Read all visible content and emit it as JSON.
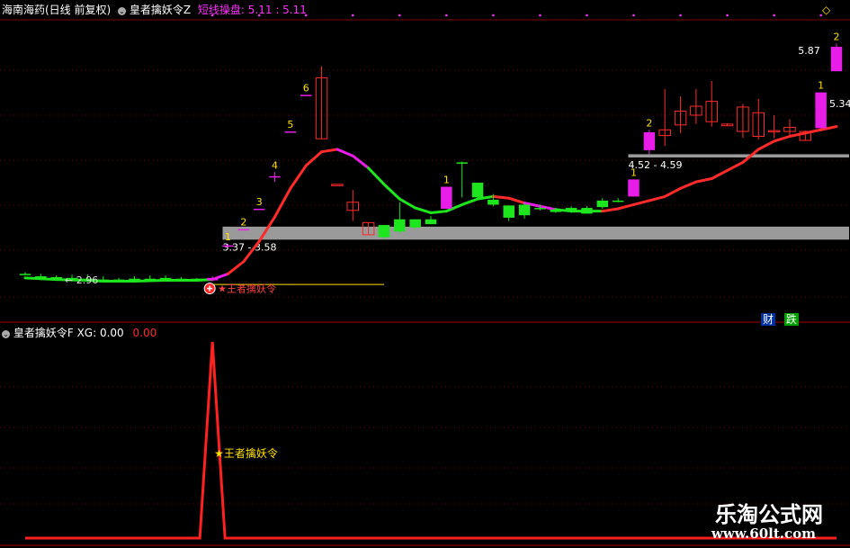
{
  "header": {
    "stock": "海南海药(日线 前复权)",
    "indicator1": "皇者擒妖令Z",
    "signal_label": "短线操盘:",
    "signal_values": "5.11 : 5.11",
    "indicator2": "皇者擒妖令F",
    "xg_label": "XG: 0.00",
    "xg_value2": "0.00"
  },
  "watermark": {
    "brand": "乐淘公式网",
    "url": "www.60lt.com"
  },
  "colors": {
    "up": "#ff2a2a",
    "down": "#1ee61e",
    "magenta": "#e81ee8",
    "gray": "#9a9a9a",
    "yellow": "#ffe000",
    "grid": "#6a0000"
  },
  "chart_data": [
    {
      "type": "candlestick",
      "price_range": [
        2.6,
        6.15
      ],
      "candles": [
        {
          "o": 3.05,
          "h": 3.07,
          "l": 3.03,
          "c": 3.05,
          "col": "down"
        },
        {
          "o": 3.02,
          "h": 3.05,
          "l": 2.99,
          "c": 3.0,
          "col": "down"
        },
        {
          "o": 3.01,
          "h": 3.03,
          "l": 2.98,
          "c": 2.99,
          "col": "down"
        },
        {
          "o": 3.0,
          "h": 3.04,
          "l": 2.97,
          "c": 2.98,
          "col": "down"
        },
        {
          "o": 2.99,
          "h": 3.04,
          "l": 2.95,
          "c": 2.97,
          "col": "down"
        },
        {
          "o": 2.98,
          "h": 3.02,
          "l": 2.96,
          "c": 2.97,
          "col": "down"
        },
        {
          "o": 2.98,
          "h": 3.0,
          "l": 2.96,
          "c": 2.97,
          "col": "down"
        },
        {
          "o": 2.99,
          "h": 3.02,
          "l": 2.96,
          "c": 2.97,
          "col": "down"
        },
        {
          "o": 2.99,
          "h": 3.03,
          "l": 2.97,
          "c": 2.98,
          "col": "down"
        },
        {
          "o": 3.0,
          "h": 3.03,
          "l": 2.97,
          "c": 2.98,
          "col": "down"
        },
        {
          "o": 2.99,
          "h": 3.01,
          "l": 2.96,
          "c": 2.97,
          "col": "down"
        },
        {
          "o": 2.96,
          "h": 3.0,
          "l": 2.96,
          "c": 2.99,
          "col": "down"
        },
        {
          "o": 2.97,
          "h": 3.02,
          "l": 2.96,
          "c": 3.0,
          "col": "magenta"
        },
        {
          "o": 3.4,
          "h": 3.42,
          "l": 3.37,
          "c": 3.4,
          "col": "magenta",
          "num": "1"
        },
        {
          "o": 3.6,
          "h": 3.6,
          "l": 3.6,
          "c": 3.6,
          "col": "magenta",
          "num": "2"
        },
        {
          "o": 3.85,
          "h": 3.85,
          "l": 3.85,
          "c": 3.85,
          "col": "magenta",
          "num": "3"
        },
        {
          "o": 4.25,
          "h": 4.3,
          "l": 4.18,
          "c": 4.25,
          "col": "magenta",
          "num": "4"
        },
        {
          "o": 4.8,
          "h": 4.8,
          "l": 4.8,
          "c": 4.8,
          "col": "magenta",
          "num": "5"
        },
        {
          "o": 5.25,
          "h": 5.25,
          "l": 5.25,
          "c": 5.25,
          "col": "magenta",
          "num": "6"
        },
        {
          "o": 4.71,
          "h": 5.6,
          "l": 4.71,
          "c": 5.46,
          "col": "up"
        },
        {
          "o": 4.15,
          "h": 4.15,
          "l": 4.15,
          "c": 4.15,
          "col": "up"
        },
        {
          "o": 3.83,
          "h": 4.08,
          "l": 3.7,
          "c": 3.93,
          "col": "up"
        },
        {
          "o": 3.53,
          "h": 3.68,
          "l": 3.53,
          "c": 3.68,
          "col": "up"
        },
        {
          "o": 3.65,
          "h": 3.65,
          "l": 3.48,
          "c": 3.5,
          "col": "down"
        },
        {
          "o": 3.72,
          "h": 3.93,
          "l": 3.55,
          "c": 3.57,
          "col": "down"
        },
        {
          "o": 3.72,
          "h": 3.72,
          "l": 3.6,
          "c": 3.62,
          "col": "down"
        },
        {
          "o": 3.72,
          "h": 3.76,
          "l": 3.66,
          "c": 3.66,
          "col": "down"
        },
        {
          "o": 3.85,
          "h": 4.12,
          "l": 3.85,
          "c": 4.12,
          "col": "magenta",
          "num": "1"
        },
        {
          "o": 4.42,
          "h": 4.43,
          "l": 3.99,
          "c": 4.41,
          "col": "down"
        },
        {
          "o": 4.17,
          "h": 4.17,
          "l": 3.98,
          "c": 3.99,
          "col": "down"
        },
        {
          "o": 3.96,
          "h": 4.03,
          "l": 3.88,
          "c": 3.9,
          "col": "down"
        },
        {
          "o": 3.89,
          "h": 3.89,
          "l": 3.7,
          "c": 3.74,
          "col": "down"
        },
        {
          "o": 3.9,
          "h": 3.92,
          "l": 3.73,
          "c": 3.77,
          "col": "down"
        },
        {
          "o": 3.86,
          "h": 3.9,
          "l": 3.83,
          "c": 3.86,
          "col": "down"
        },
        {
          "o": 3.84,
          "h": 3.86,
          "l": 3.8,
          "c": 3.81,
          "col": "down"
        },
        {
          "o": 3.86,
          "h": 3.88,
          "l": 3.8,
          "c": 3.83,
          "col": "down"
        },
        {
          "o": 3.86,
          "h": 3.88,
          "l": 3.79,
          "c": 3.79,
          "col": "down"
        },
        {
          "o": 3.95,
          "h": 3.98,
          "l": 3.85,
          "c": 3.87,
          "col": "down"
        },
        {
          "o": 3.95,
          "h": 3.98,
          "l": 3.93,
          "c": 3.95,
          "col": "down"
        },
        {
          "o": 4.0,
          "h": 4.21,
          "l": 4.0,
          "c": 4.21,
          "col": "magenta",
          "num": "1"
        },
        {
          "o": 4.57,
          "h": 4.82,
          "l": 4.52,
          "c": 4.79,
          "col": "magenta",
          "num": "2"
        },
        {
          "o": 4.75,
          "h": 5.32,
          "l": 4.62,
          "c": 4.82,
          "col": "up"
        },
        {
          "o": 4.88,
          "h": 5.23,
          "l": 4.78,
          "c": 5.05,
          "col": "up"
        },
        {
          "o": 5.0,
          "h": 5.32,
          "l": 4.89,
          "c": 5.11,
          "col": "up"
        },
        {
          "o": 4.92,
          "h": 5.42,
          "l": 4.86,
          "c": 5.17,
          "col": "up"
        },
        {
          "o": 4.87,
          "h": 4.9,
          "l": 4.87,
          "c": 4.89,
          "col": "up"
        },
        {
          "o": 4.8,
          "h": 5.14,
          "l": 4.72,
          "c": 5.1,
          "col": "up"
        },
        {
          "o": 4.74,
          "h": 5.2,
          "l": 4.7,
          "c": 5.03,
          "col": "up"
        },
        {
          "o": 4.81,
          "h": 5.0,
          "l": 4.72,
          "c": 4.8,
          "col": "up"
        },
        {
          "o": 4.8,
          "h": 4.95,
          "l": 4.75,
          "c": 4.85,
          "col": "up"
        },
        {
          "o": 4.69,
          "h": 4.81,
          "l": 4.69,
          "c": 4.8,
          "col": "up"
        },
        {
          "o": 4.84,
          "h": 5.28,
          "l": 4.84,
          "c": 5.28,
          "col": "magenta",
          "num": "1"
        },
        {
          "o": 5.54,
          "h": 5.88,
          "l": 5.54,
          "c": 5.84,
          "col": "magenta",
          "num": "2"
        }
      ],
      "ma_line": {
        "values": [
          3.0,
          2.99,
          2.98,
          2.975,
          2.97,
          2.96,
          2.96,
          2.96,
          2.965,
          2.97,
          2.97,
          2.97,
          2.98,
          3.05,
          3.2,
          3.45,
          3.75,
          4.1,
          4.38,
          4.55,
          4.58,
          4.5,
          4.35,
          4.15,
          3.97,
          3.86,
          3.8,
          3.82,
          3.9,
          3.97,
          4.0,
          3.98,
          3.92,
          3.88,
          3.84,
          3.82,
          3.82,
          3.82,
          3.85,
          3.9,
          3.95,
          4.0,
          4.1,
          4.18,
          4.22,
          4.32,
          4.42,
          4.58,
          4.68,
          4.74,
          4.78,
          4.82,
          4.86
        ],
        "colors": [
          "down",
          "down",
          "down",
          "down",
          "down",
          "down",
          "down",
          "down",
          "down",
          "down",
          "down",
          "down",
          "magenta",
          "up",
          "up",
          "up",
          "up",
          "up",
          "up",
          "up",
          "magenta",
          "magenta",
          "down",
          "down",
          "down",
          "down",
          "down",
          "down",
          "down",
          "down",
          "up",
          "up",
          "magenta",
          "magenta",
          "down",
          "down",
          "down",
          "up",
          "up",
          "up",
          "up",
          "up",
          "up",
          "up",
          "up",
          "up",
          "up",
          "up",
          "up",
          "up",
          "up",
          "up",
          "up"
        ]
      },
      "zones": [
        {
          "from": 13,
          "to": 52,
          "top": 3.63,
          "bottom": 3.47,
          "label": "3.37 - 3.58",
          "label_index": 13,
          "label_price": 3.38
        },
        {
          "from": 39,
          "to": 52,
          "top": 4.52,
          "bottom": 4.48,
          "label": "4.52 - 4.59",
          "label_index": 39,
          "label_price": 4.39
        }
      ],
      "annotations": [
        {
          "text": "← 2.96",
          "index": 3,
          "price": 2.93,
          "color": "#dddddd"
        },
        {
          "text": "5.87",
          "index": 50,
          "price": 5.75,
          "color": "#ffffff"
        },
        {
          "text": "5.34",
          "index": 52,
          "price": 5.1,
          "color": "#ffffff"
        }
      ],
      "signal": {
        "index": 12,
        "label": "王者擒妖令",
        "price": 2.87
      }
    },
    {
      "type": "line",
      "title": "皇者擒妖令F",
      "series": [
        {
          "name": "XG",
          "values": [
            0,
            0,
            0,
            0,
            0,
            0,
            0,
            0,
            0,
            0,
            0,
            0,
            1,
            0,
            0,
            0,
            0,
            0,
            0,
            0,
            0,
            0,
            0,
            0,
            0,
            0,
            0,
            0,
            0,
            0,
            0,
            0,
            0,
            0,
            0,
            0,
            0,
            0,
            0,
            0,
            0,
            0,
            0,
            0,
            0,
            0,
            0,
            0,
            0,
            0,
            0,
            0,
            0
          ]
        }
      ],
      "signal_label": "王者擒妖令"
    }
  ]
}
